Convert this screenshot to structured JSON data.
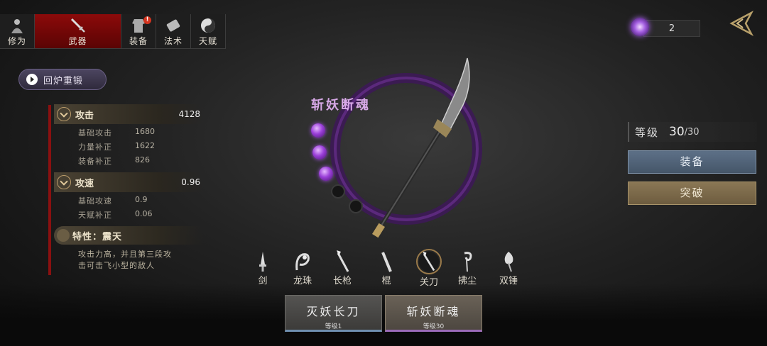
{
  "tabs": [
    {
      "label": "修为",
      "icon": "cultivator-icon"
    },
    {
      "label": "武器",
      "icon": "sword-icon",
      "active": true
    },
    {
      "label": "装备",
      "icon": "armor-icon",
      "badge": "!"
    },
    {
      "label": "法术",
      "icon": "scroll-icon"
    },
    {
      "label": "天赋",
      "icon": "taiji-icon"
    }
  ],
  "reforge_label": "回炉重锻",
  "stats": {
    "attack": {
      "title": "攻击",
      "value": "4128",
      "rows": [
        {
          "k": "基础攻击",
          "v": "1680"
        },
        {
          "k": "力量补正",
          "v": "1622"
        },
        {
          "k": "装备补正",
          "v": "826"
        }
      ]
    },
    "speed": {
      "title": "攻速",
      "value": "0.96",
      "rows": [
        {
          "k": "基础攻速",
          "v": "0.9"
        },
        {
          "k": "天赋补正",
          "v": "0.06"
        }
      ]
    },
    "trait": {
      "title": "特性：震天",
      "desc": "攻击力高，并且第三段攻击可击飞小型的敌人"
    }
  },
  "weapon": {
    "name": "斩妖断魂",
    "orbs_filled": 3,
    "orbs_total": 5
  },
  "currency": {
    "value": "2",
    "icon": "purple-gem-icon"
  },
  "level": {
    "label": "等级",
    "value": "30",
    "max": "/30"
  },
  "buttons": {
    "equip": "装备",
    "breakthrough": "突破"
  },
  "weapon_types": [
    {
      "label": "剑"
    },
    {
      "label": "龙珠"
    },
    {
      "label": "长枪"
    },
    {
      "label": "棍"
    },
    {
      "label": "关刀",
      "selected": true
    },
    {
      "label": "拂尘"
    },
    {
      "label": "双锤"
    }
  ],
  "cards": [
    {
      "name": "灭妖长刀",
      "level": "等级1"
    },
    {
      "name": "斩妖断魂",
      "level": "等级30"
    }
  ],
  "colors": {
    "accent_red": "#8c0a0a",
    "purple": "#9a3fd8",
    "equip_blue": "#5d7087",
    "break_gold": "#8a7755"
  }
}
